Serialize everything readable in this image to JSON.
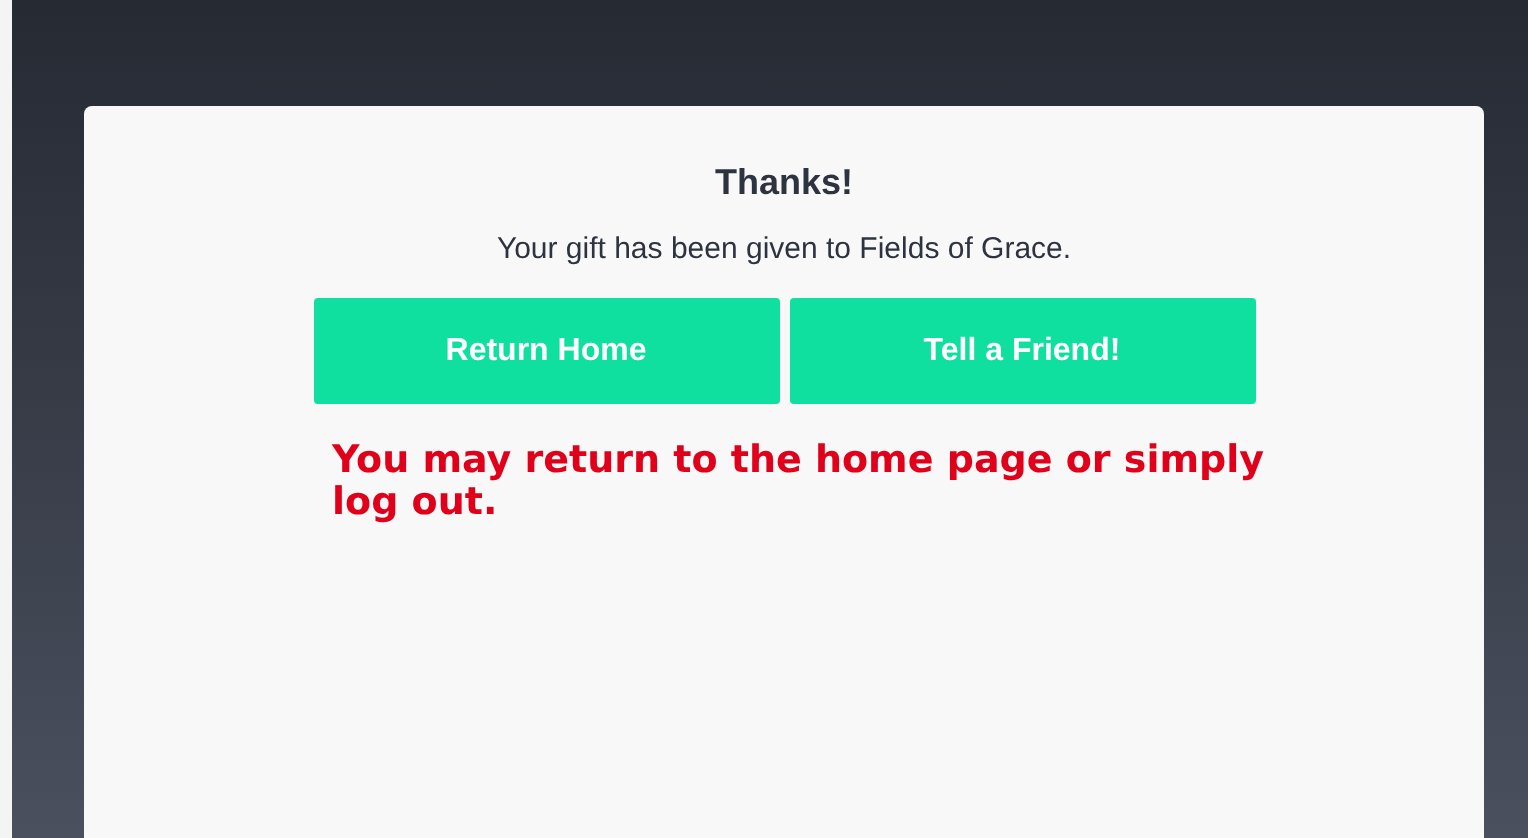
{
  "card": {
    "title": "Thanks!",
    "message": "Your gift has been given to Fields of Grace.",
    "buttons": [
      "Return Home",
      "Tell a Friend!"
    ],
    "note": "You may return to the home page or simply log out."
  }
}
